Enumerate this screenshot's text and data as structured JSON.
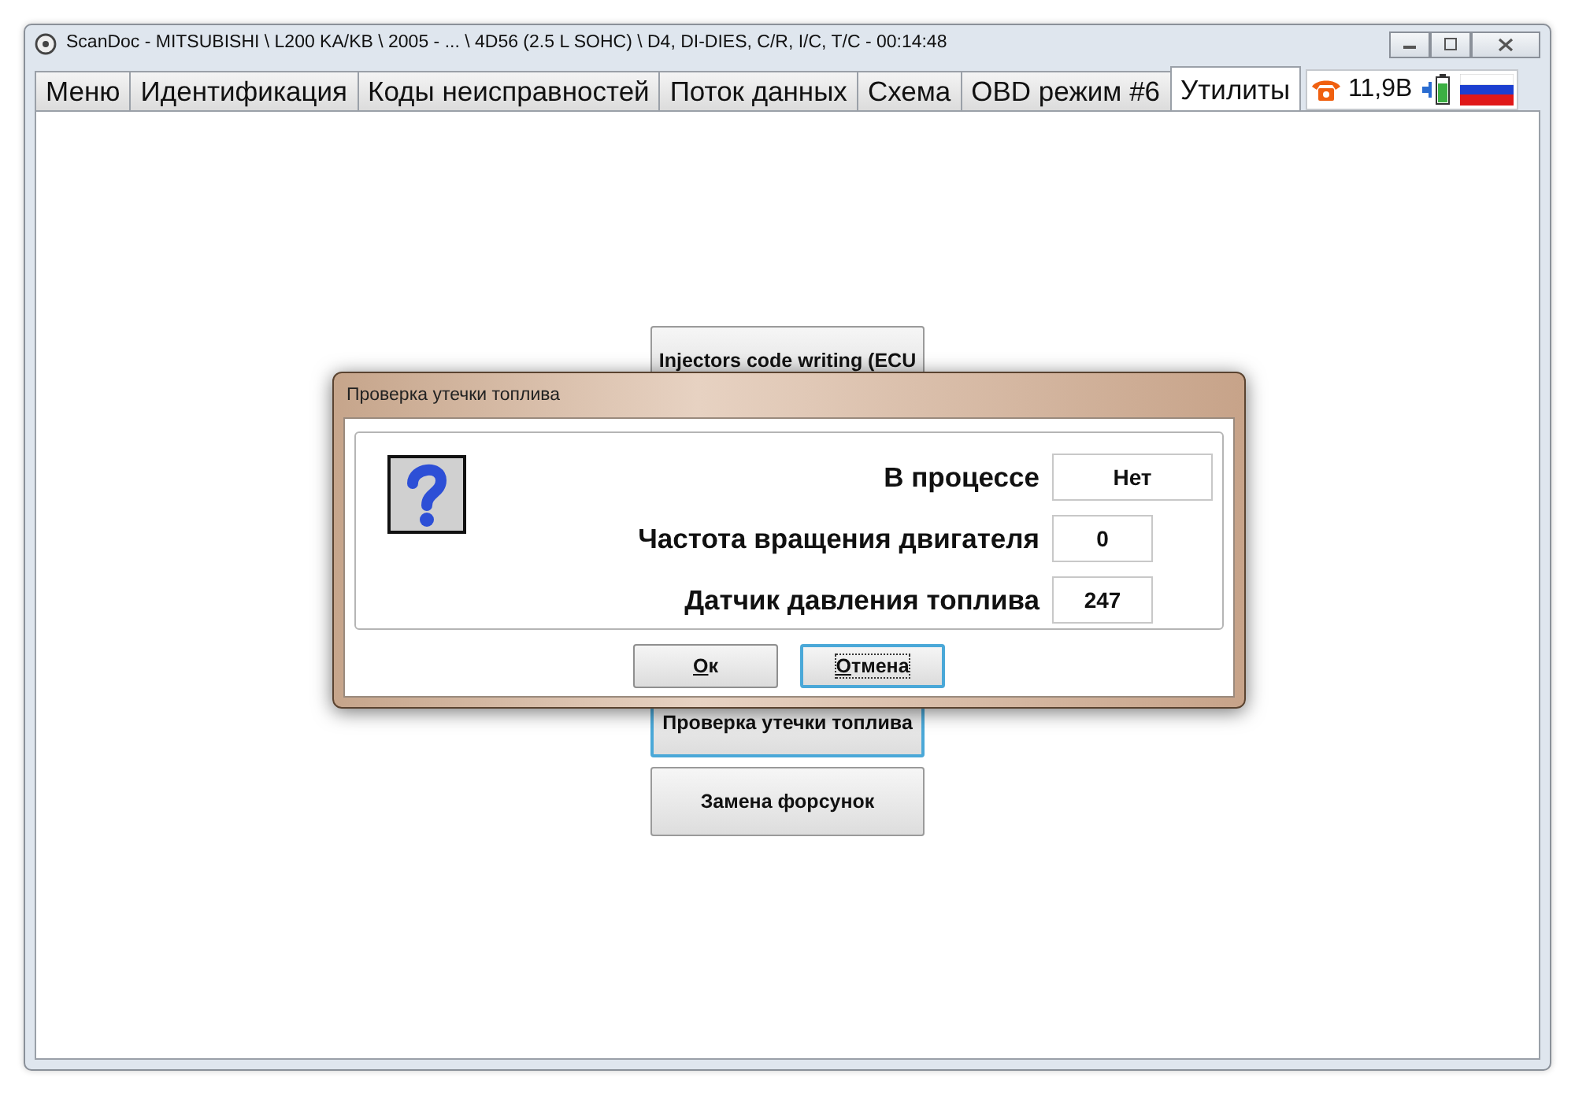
{
  "window": {
    "title": "ScanDoc - MITSUBISHI \\ L200 KA/KB \\ 2005 - ... \\ 4D56 (2.5 L SOHC) \\ D4, DI-DIES, C/R, I/C, T/C - 00:14:48"
  },
  "tabs": [
    {
      "label": "Меню",
      "selected": false
    },
    {
      "label": "Идентификация",
      "selected": false
    },
    {
      "label": "Коды неисправностей",
      "selected": false
    },
    {
      "label": "Поток данных",
      "selected": false
    },
    {
      "label": "Схема",
      "selected": false
    },
    {
      "label": "OBD режим #6",
      "selected": false
    },
    {
      "label": "Утилиты",
      "selected": true
    }
  ],
  "status": {
    "voltage": "11,9В"
  },
  "utilities": [
    {
      "label": "Injectors code writing (ECU",
      "focused": false
    },
    {
      "label": "Проверка утечки топлива",
      "focused": true
    },
    {
      "label": "Замена форсунок",
      "focused": false
    }
  ],
  "dialog": {
    "title": "Проверка утечки топлива",
    "fields": [
      {
        "label": "В процессе",
        "value": "Нет"
      },
      {
        "label": "Частота вращения двигателя",
        "value": "0"
      },
      {
        "label": "Датчик давления топлива",
        "value": "247"
      }
    ],
    "buttons": [
      {
        "label": "Ок",
        "focused": false
      },
      {
        "label": "Отмена",
        "focused": true
      }
    ]
  }
}
